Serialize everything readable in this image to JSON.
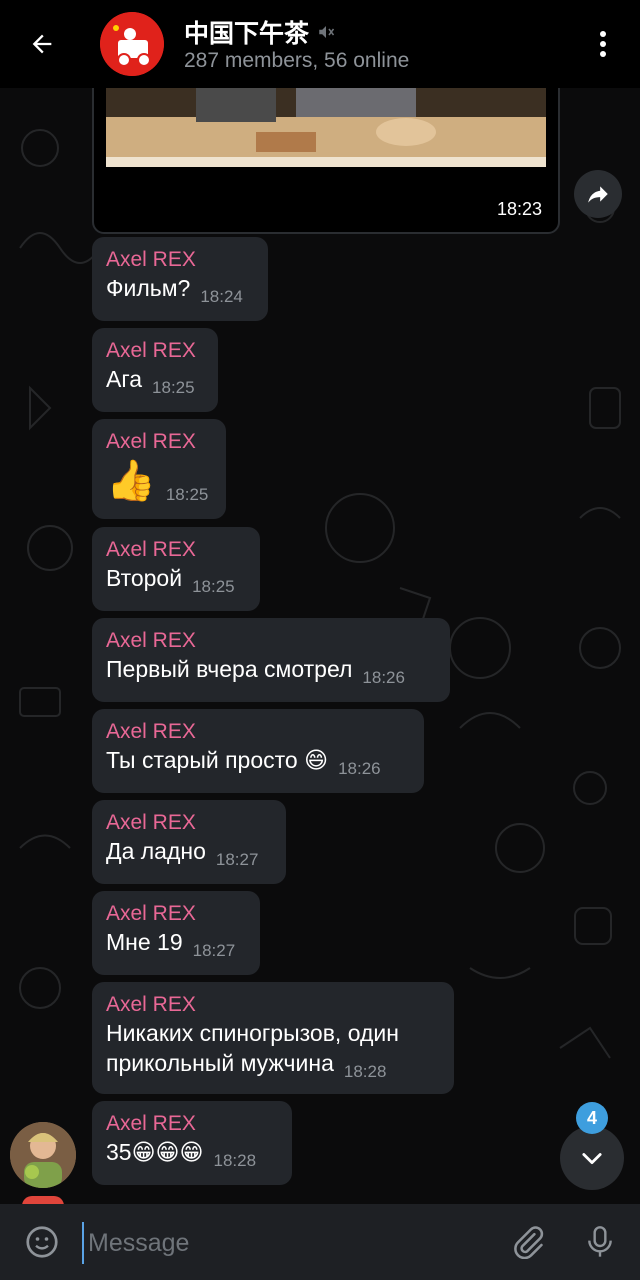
{
  "header": {
    "title": "中国下午茶",
    "subtitle": "287 members, 56 online",
    "muted_icon": "muted-speaker-icon",
    "back_icon": "arrow-left-icon",
    "menu_icon": "more-vertical-icon"
  },
  "media_message": {
    "time": "18:23"
  },
  "messages": [
    {
      "sender": "Axel REX",
      "text": "Фильм?",
      "time": "18:24"
    },
    {
      "sender": "Axel REX",
      "text": "Ага",
      "time": "18:25"
    },
    {
      "sender": "Axel REX",
      "text": "👍",
      "time": "18:25"
    },
    {
      "sender": "Axel REX",
      "text": "Второй",
      "time": "18:25"
    },
    {
      "sender": "Axel REX",
      "text": "Первый вчера смотрел",
      "time": "18:26"
    },
    {
      "sender": "Axel REX",
      "text": "Ты старый просто 😄",
      "time": "18:26"
    },
    {
      "sender": "Axel REX",
      "text": "Да ладно",
      "time": "18:27"
    },
    {
      "sender": "Axel REX",
      "text": "Мне 19",
      "time": "18:27"
    },
    {
      "sender": "Axel REX",
      "text": "Никаких спиногрызов, один\nприкольный мужчина",
      "time": "18:28"
    },
    {
      "sender": "Axel REX",
      "text": "35😁😁😁",
      "time": "18:28"
    }
  ],
  "scroll": {
    "unread_count": "4"
  },
  "input": {
    "placeholder": "Message"
  },
  "colors": {
    "sender_name": "#e96896",
    "bubble": "#23262b",
    "accent": "#3e9ede"
  }
}
